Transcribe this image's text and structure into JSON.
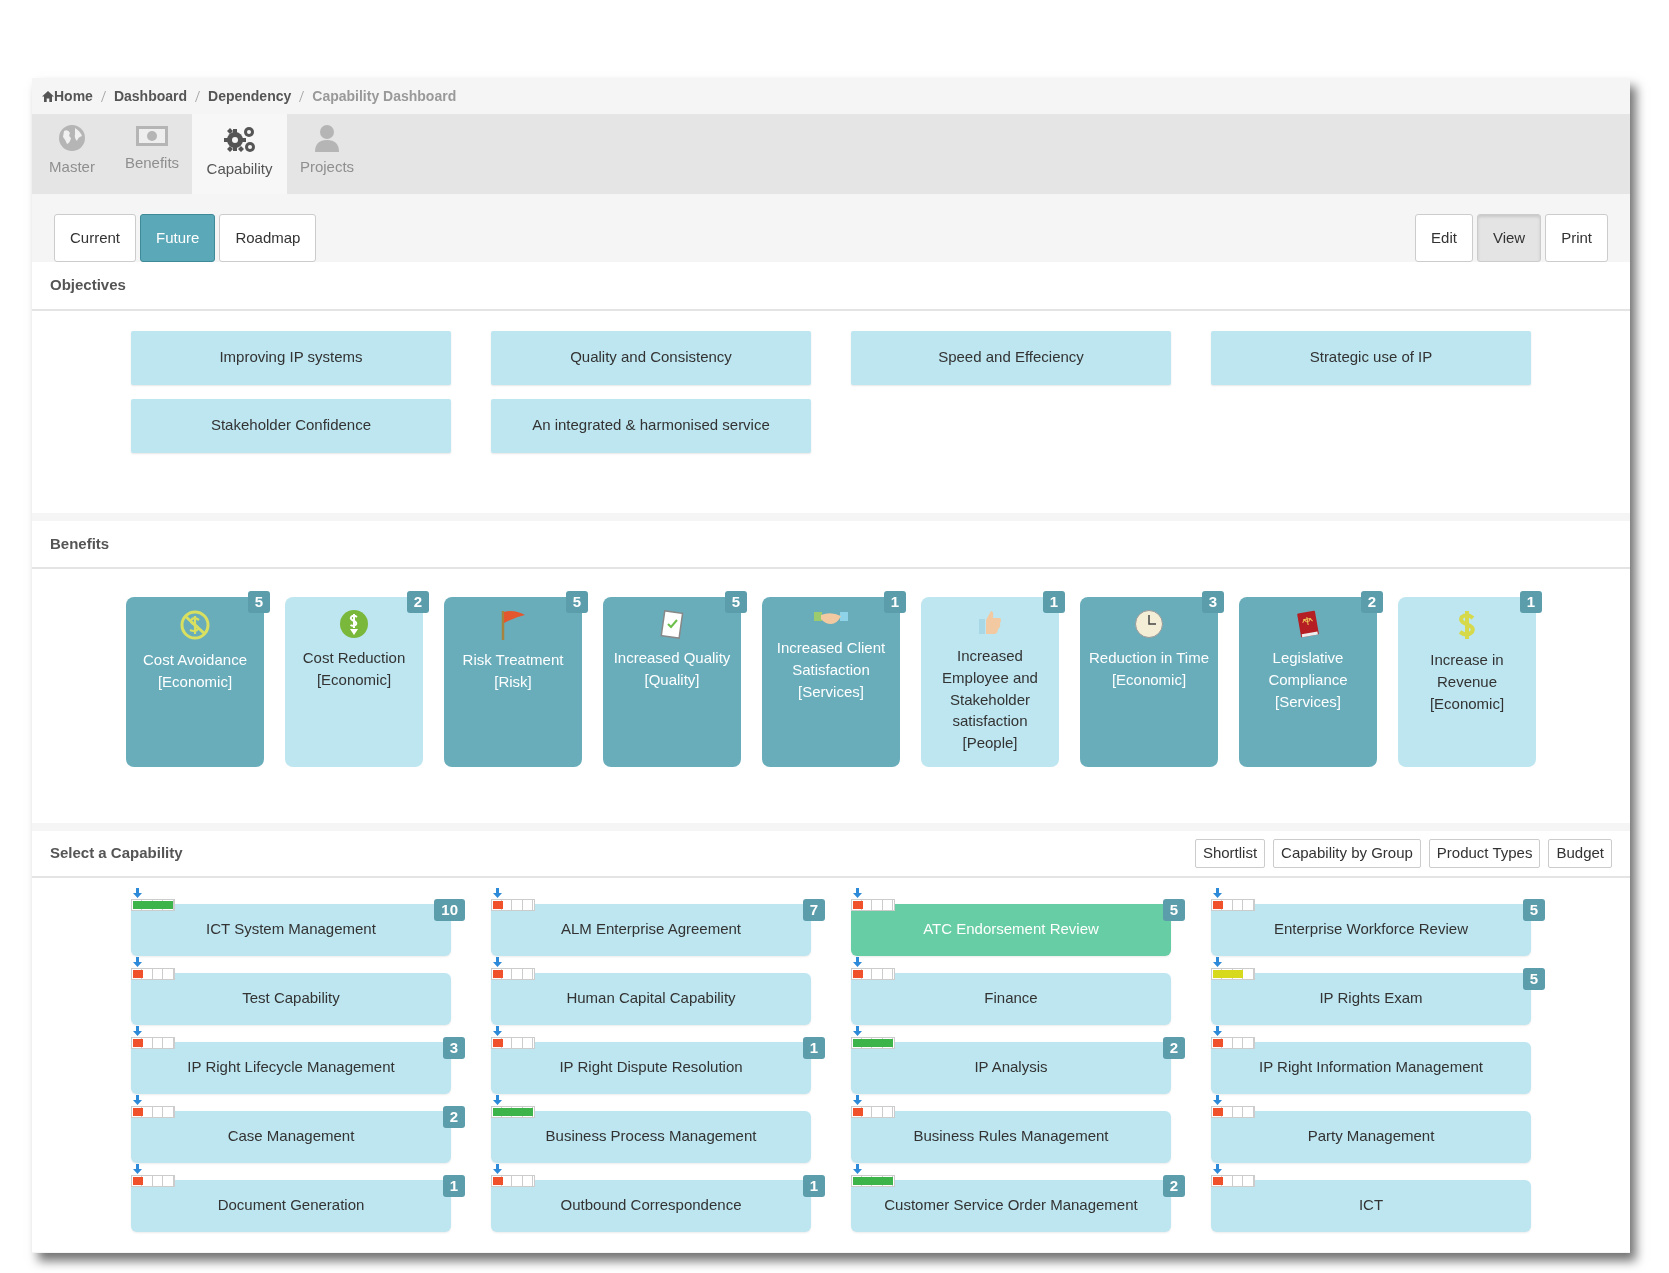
{
  "breadcrumb": [
    {
      "label": "Home",
      "current": false
    },
    {
      "label": "Dashboard",
      "current": false
    },
    {
      "label": "Dependency",
      "current": false
    },
    {
      "label": "Capability Dashboard",
      "current": true
    }
  ],
  "nav_tabs": [
    {
      "label": "Master",
      "selected": false
    },
    {
      "label": "Benefits",
      "selected": false
    },
    {
      "label": "Capability",
      "selected": true
    },
    {
      "label": "Projects",
      "selected": false
    }
  ],
  "view_modes": [
    {
      "label": "Current",
      "selected": false
    },
    {
      "label": "Future",
      "selected": true
    },
    {
      "label": "Roadmap",
      "selected": false
    }
  ],
  "actions": [
    {
      "label": "Edit",
      "selected": false
    },
    {
      "label": "View",
      "selected": true
    },
    {
      "label": "Print",
      "selected": false
    }
  ],
  "objectives": {
    "title": "Objectives",
    "items": [
      "Improving IP systems",
      "Quality and Consistency",
      "Speed and Effeciency",
      "Strategic use of IP",
      "Stakeholder Confidence",
      "An integrated & harmonised service"
    ]
  },
  "benefits": {
    "title": "Benefits",
    "items": [
      {
        "name": "Cost Avoidance [Economic]",
        "count": "5",
        "selected": true
      },
      {
        "name": "Cost Reduction [Economic]",
        "count": "2",
        "selected": false
      },
      {
        "name": "Risk Treatment [Risk]",
        "count": "5",
        "selected": true
      },
      {
        "name": "Increased Quality [Quality]",
        "count": "5",
        "selected": true
      },
      {
        "name": "Increased Client Satisfaction [Services]",
        "count": "1",
        "selected": true
      },
      {
        "name": "Increased Employee and Stakeholder satisfaction [People]",
        "count": "1",
        "selected": false
      },
      {
        "name": "Reduction in Time [Economic]",
        "count": "3",
        "selected": true
      },
      {
        "name": "Legislative Compliance [Services]",
        "count": "2",
        "selected": true
      },
      {
        "name": "Increase in Revenue [Economic]",
        "count": "1",
        "selected": false
      }
    ]
  },
  "capabilities": {
    "title": "Select a Capability",
    "filters": [
      "Shortlist",
      "Capability by Group",
      "Product Types",
      "Budget"
    ],
    "items": [
      {
        "name": "ICT System Management",
        "count": "10",
        "selected": false,
        "level": 1,
        "color": "#3cb44a"
      },
      {
        "name": "ALM Enterprise Agreement",
        "count": "7",
        "selected": false,
        "level": 0.25,
        "color": "#f0512a"
      },
      {
        "name": "ATC Endorsement Review",
        "count": "5",
        "selected": true,
        "level": 0.25,
        "color": "#f0512a"
      },
      {
        "name": "Enterprise Workforce Review",
        "count": "5",
        "selected": false,
        "level": 0.25,
        "color": "#f0512a"
      },
      {
        "name": "Test Capability",
        "selected": false,
        "level": 0.25,
        "color": "#f0512a"
      },
      {
        "name": "Human Capital Capability",
        "selected": false,
        "level": 0.25,
        "color": "#f0512a"
      },
      {
        "name": "Finance",
        "selected": false,
        "level": 0.25,
        "color": "#f0512a"
      },
      {
        "name": "IP Rights Exam",
        "count": "5",
        "selected": false,
        "level": 0.75,
        "color": "#d6d91c"
      },
      {
        "name": "IP Right Lifecycle Management",
        "count": "3",
        "selected": false,
        "level": 0.25,
        "color": "#f0512a"
      },
      {
        "name": "IP Right Dispute Resolution",
        "count": "1",
        "selected": false,
        "level": 0.25,
        "color": "#f0512a"
      },
      {
        "name": "IP Analysis",
        "count": "2",
        "selected": false,
        "level": 1,
        "color": "#3cb44a"
      },
      {
        "name": "IP Right Information Management",
        "selected": false,
        "level": 0.25,
        "color": "#f0512a"
      },
      {
        "name": "Case Management",
        "count": "2",
        "selected": false,
        "level": 0.25,
        "color": "#f0512a"
      },
      {
        "name": "Business Process Management",
        "selected": false,
        "level": 1,
        "color": "#3cb44a"
      },
      {
        "name": "Business Rules Management",
        "selected": false,
        "level": 0.25,
        "color": "#f0512a"
      },
      {
        "name": "Party Management",
        "selected": false,
        "level": 0.25,
        "color": "#f0512a"
      },
      {
        "name": "Document Generation",
        "count": "1",
        "selected": false,
        "level": 0.25,
        "color": "#f0512a"
      },
      {
        "name": "Outbound Correspondence",
        "count": "1",
        "selected": false,
        "level": 0.25,
        "color": "#f0512a"
      },
      {
        "name": "Customer Service Order Management",
        "count": "2",
        "selected": false,
        "level": 1,
        "color": "#3cb44a"
      },
      {
        "name": "ICT",
        "selected": false,
        "level": 0.25,
        "color": "#f0512a"
      }
    ]
  }
}
